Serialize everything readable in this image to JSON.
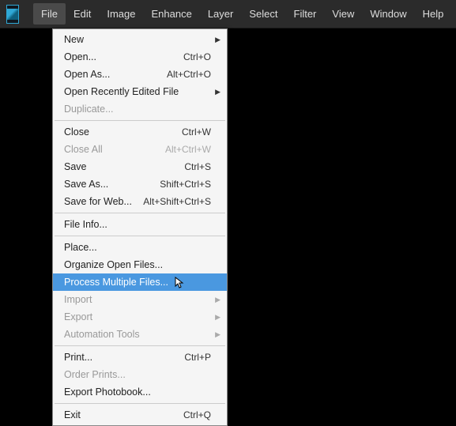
{
  "menubar": [
    "File",
    "Edit",
    "Image",
    "Enhance",
    "Layer",
    "Select",
    "Filter",
    "View",
    "Window",
    "Help"
  ],
  "active_menu_index": 0,
  "dropdown": {
    "groups": [
      [
        {
          "label": "New",
          "submenu": true
        },
        {
          "label": "Open...",
          "shortcut": "Ctrl+O"
        },
        {
          "label": "Open As...",
          "shortcut": "Alt+Ctrl+O"
        },
        {
          "label": "Open Recently Edited File",
          "submenu": true
        },
        {
          "label": "Duplicate...",
          "disabled": true
        }
      ],
      [
        {
          "label": "Close",
          "shortcut": "Ctrl+W"
        },
        {
          "label": "Close All",
          "shortcut": "Alt+Ctrl+W",
          "disabled": true
        },
        {
          "label": "Save",
          "shortcut": "Ctrl+S"
        },
        {
          "label": "Save As...",
          "shortcut": "Shift+Ctrl+S"
        },
        {
          "label": "Save for Web...",
          "shortcut": "Alt+Shift+Ctrl+S"
        }
      ],
      [
        {
          "label": "File Info..."
        }
      ],
      [
        {
          "label": "Place..."
        },
        {
          "label": "Organize Open Files..."
        },
        {
          "label": "Process Multiple Files...",
          "highlight": true
        },
        {
          "label": "Import",
          "submenu": true,
          "disabled": true
        },
        {
          "label": "Export",
          "submenu": true,
          "disabled": true
        },
        {
          "label": "Automation Tools",
          "submenu": true,
          "disabled": true
        }
      ],
      [
        {
          "label": "Print...",
          "shortcut": "Ctrl+P"
        },
        {
          "label": "Order Prints...",
          "disabled": true
        },
        {
          "label": "Export Photobook..."
        }
      ],
      [
        {
          "label": "Exit",
          "shortcut": "Ctrl+Q"
        }
      ]
    ]
  }
}
